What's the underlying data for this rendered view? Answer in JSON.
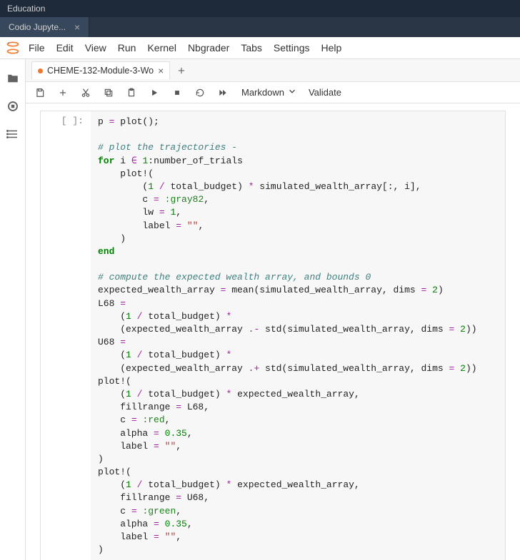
{
  "titlebar": {
    "title": "Education"
  },
  "tabs": [
    {
      "label": "Codio Jupyte...",
      "active": true
    }
  ],
  "menubar": [
    "File",
    "Edit",
    "View",
    "Run",
    "Kernel",
    "Nbgrader",
    "Tabs",
    "Settings",
    "Help"
  ],
  "file_tab": {
    "label": "CHEME-132-Module-3-Wo",
    "modified_dot": true
  },
  "toolbar": {
    "cell_type": "Markdown",
    "validate": "Validate"
  },
  "cell_prompt": "[ ]:",
  "code_tokens": [
    {
      "t": "p ",
      "c": ""
    },
    {
      "t": "=",
      "c": "c-op"
    },
    {
      "t": " plot();",
      "c": ""
    },
    {
      "t": "\n",
      "c": ""
    },
    {
      "t": "\n",
      "c": ""
    },
    {
      "t": "# plot the trajectories -",
      "c": "c-comment"
    },
    {
      "t": "\n",
      "c": ""
    },
    {
      "t": "for",
      "c": "c-kw"
    },
    {
      "t": " i ",
      "c": ""
    },
    {
      "t": "∈",
      "c": "c-op"
    },
    {
      "t": " ",
      "c": ""
    },
    {
      "t": "1",
      "c": "c-num"
    },
    {
      "t": ":number_of_trials",
      "c": ""
    },
    {
      "t": "\n",
      "c": ""
    },
    {
      "t": "    plot!(",
      "c": ""
    },
    {
      "t": "\n",
      "c": ""
    },
    {
      "t": "        (",
      "c": ""
    },
    {
      "t": "1",
      "c": "c-num"
    },
    {
      "t": " ",
      "c": ""
    },
    {
      "t": "/",
      "c": "c-op"
    },
    {
      "t": " total_budget) ",
      "c": ""
    },
    {
      "t": "*",
      "c": "c-op"
    },
    {
      "t": " simulated_wealth_array[:, i],",
      "c": ""
    },
    {
      "t": "\n",
      "c": ""
    },
    {
      "t": "        c ",
      "c": ""
    },
    {
      "t": "=",
      "c": "c-op"
    },
    {
      "t": " ",
      "c": ""
    },
    {
      "t": ":gray82",
      "c": "c-sym"
    },
    {
      "t": ",",
      "c": ""
    },
    {
      "t": "\n",
      "c": ""
    },
    {
      "t": "        lw ",
      "c": ""
    },
    {
      "t": "=",
      "c": "c-op"
    },
    {
      "t": " ",
      "c": ""
    },
    {
      "t": "1",
      "c": "c-num"
    },
    {
      "t": ",",
      "c": ""
    },
    {
      "t": "\n",
      "c": ""
    },
    {
      "t": "        label ",
      "c": ""
    },
    {
      "t": "=",
      "c": "c-op"
    },
    {
      "t": " ",
      "c": ""
    },
    {
      "t": "\"\"",
      "c": "c-str"
    },
    {
      "t": ",",
      "c": ""
    },
    {
      "t": "\n",
      "c": ""
    },
    {
      "t": "    )",
      "c": ""
    },
    {
      "t": "\n",
      "c": ""
    },
    {
      "t": "end",
      "c": "c-kw"
    },
    {
      "t": "\n",
      "c": ""
    },
    {
      "t": "\n",
      "c": ""
    },
    {
      "t": "# compute the expected wealth array, and bounds 0",
      "c": "c-comment"
    },
    {
      "t": "\n",
      "c": ""
    },
    {
      "t": "expected_wealth_array ",
      "c": ""
    },
    {
      "t": "=",
      "c": "c-op"
    },
    {
      "t": " mean(simulated_wealth_array, dims ",
      "c": ""
    },
    {
      "t": "=",
      "c": "c-op"
    },
    {
      "t": " ",
      "c": ""
    },
    {
      "t": "2",
      "c": "c-num"
    },
    {
      "t": ")",
      "c": ""
    },
    {
      "t": "\n",
      "c": ""
    },
    {
      "t": "L68 ",
      "c": ""
    },
    {
      "t": "=",
      "c": "c-op"
    },
    {
      "t": "\n",
      "c": ""
    },
    {
      "t": "    (",
      "c": ""
    },
    {
      "t": "1",
      "c": "c-num"
    },
    {
      "t": " ",
      "c": ""
    },
    {
      "t": "/",
      "c": "c-op"
    },
    {
      "t": " total_budget) ",
      "c": ""
    },
    {
      "t": "*",
      "c": "c-op"
    },
    {
      "t": "\n",
      "c": ""
    },
    {
      "t": "    (expected_wealth_array ",
      "c": ""
    },
    {
      "t": ".-",
      "c": "c-op"
    },
    {
      "t": " std(simulated_wealth_array, dims ",
      "c": ""
    },
    {
      "t": "=",
      "c": "c-op"
    },
    {
      "t": " ",
      "c": ""
    },
    {
      "t": "2",
      "c": "c-num"
    },
    {
      "t": "))",
      "c": ""
    },
    {
      "t": "\n",
      "c": ""
    },
    {
      "t": "U68 ",
      "c": ""
    },
    {
      "t": "=",
      "c": "c-op"
    },
    {
      "t": "\n",
      "c": ""
    },
    {
      "t": "    (",
      "c": ""
    },
    {
      "t": "1",
      "c": "c-num"
    },
    {
      "t": " ",
      "c": ""
    },
    {
      "t": "/",
      "c": "c-op"
    },
    {
      "t": " total_budget) ",
      "c": ""
    },
    {
      "t": "*",
      "c": "c-op"
    },
    {
      "t": "\n",
      "c": ""
    },
    {
      "t": "    (expected_wealth_array ",
      "c": ""
    },
    {
      "t": ".+",
      "c": "c-op"
    },
    {
      "t": " std(simulated_wealth_array, dims ",
      "c": ""
    },
    {
      "t": "=",
      "c": "c-op"
    },
    {
      "t": " ",
      "c": ""
    },
    {
      "t": "2",
      "c": "c-num"
    },
    {
      "t": "))",
      "c": ""
    },
    {
      "t": "\n",
      "c": ""
    },
    {
      "t": "plot!(",
      "c": ""
    },
    {
      "t": "\n",
      "c": ""
    },
    {
      "t": "    (",
      "c": ""
    },
    {
      "t": "1",
      "c": "c-num"
    },
    {
      "t": " ",
      "c": ""
    },
    {
      "t": "/",
      "c": "c-op"
    },
    {
      "t": " total_budget) ",
      "c": ""
    },
    {
      "t": "*",
      "c": "c-op"
    },
    {
      "t": " expected_wealth_array,",
      "c": ""
    },
    {
      "t": "\n",
      "c": ""
    },
    {
      "t": "    fillrange ",
      "c": ""
    },
    {
      "t": "=",
      "c": "c-op"
    },
    {
      "t": " L68,",
      "c": ""
    },
    {
      "t": "\n",
      "c": ""
    },
    {
      "t": "    c ",
      "c": ""
    },
    {
      "t": "=",
      "c": "c-op"
    },
    {
      "t": " ",
      "c": ""
    },
    {
      "t": ":red",
      "c": "c-sym"
    },
    {
      "t": ",",
      "c": ""
    },
    {
      "t": "\n",
      "c": ""
    },
    {
      "t": "    alpha ",
      "c": ""
    },
    {
      "t": "=",
      "c": "c-op"
    },
    {
      "t": " ",
      "c": ""
    },
    {
      "t": "0.35",
      "c": "c-num"
    },
    {
      "t": ",",
      "c": ""
    },
    {
      "t": "\n",
      "c": ""
    },
    {
      "t": "    label ",
      "c": ""
    },
    {
      "t": "=",
      "c": "c-op"
    },
    {
      "t": " ",
      "c": ""
    },
    {
      "t": "\"\"",
      "c": "c-str"
    },
    {
      "t": ",",
      "c": ""
    },
    {
      "t": "\n",
      "c": ""
    },
    {
      "t": ")",
      "c": ""
    },
    {
      "t": "\n",
      "c": ""
    },
    {
      "t": "plot!(",
      "c": ""
    },
    {
      "t": "\n",
      "c": ""
    },
    {
      "t": "    (",
      "c": ""
    },
    {
      "t": "1",
      "c": "c-num"
    },
    {
      "t": " ",
      "c": ""
    },
    {
      "t": "/",
      "c": "c-op"
    },
    {
      "t": " total_budget) ",
      "c": ""
    },
    {
      "t": "*",
      "c": "c-op"
    },
    {
      "t": " expected_wealth_array,",
      "c": ""
    },
    {
      "t": "\n",
      "c": ""
    },
    {
      "t": "    fillrange ",
      "c": ""
    },
    {
      "t": "=",
      "c": "c-op"
    },
    {
      "t": " U68,",
      "c": ""
    },
    {
      "t": "\n",
      "c": ""
    },
    {
      "t": "    c ",
      "c": ""
    },
    {
      "t": "=",
      "c": "c-op"
    },
    {
      "t": " ",
      "c": ""
    },
    {
      "t": ":green",
      "c": "c-sym"
    },
    {
      "t": ",",
      "c": ""
    },
    {
      "t": "\n",
      "c": ""
    },
    {
      "t": "    alpha ",
      "c": ""
    },
    {
      "t": "=",
      "c": "c-op"
    },
    {
      "t": " ",
      "c": ""
    },
    {
      "t": "0.35",
      "c": "c-num"
    },
    {
      "t": ",",
      "c": ""
    },
    {
      "t": "\n",
      "c": ""
    },
    {
      "t": "    label ",
      "c": ""
    },
    {
      "t": "=",
      "c": "c-op"
    },
    {
      "t": " ",
      "c": ""
    },
    {
      "t": "\"\"",
      "c": "c-str"
    },
    {
      "t": ",",
      "c": ""
    },
    {
      "t": "\n",
      "c": ""
    },
    {
      "t": ")",
      "c": ""
    }
  ]
}
